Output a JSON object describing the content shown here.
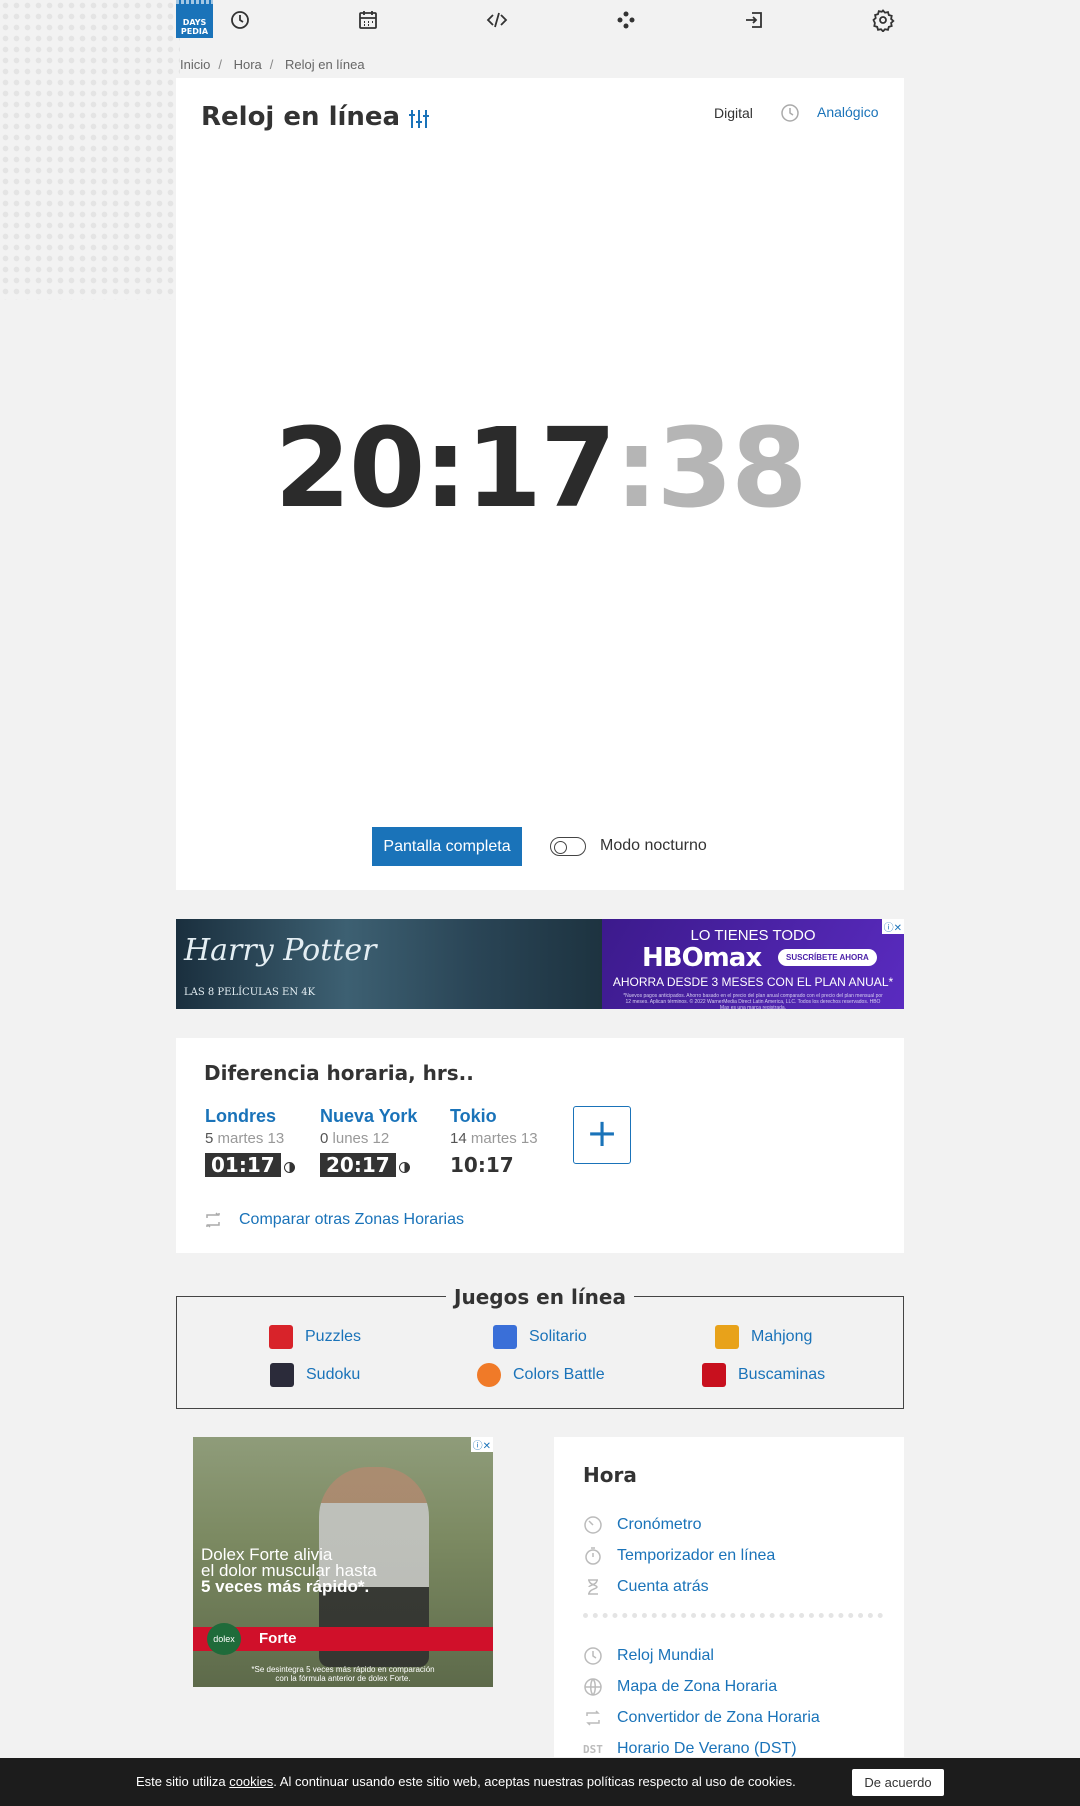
{
  "nav": {
    "logo_line1": "DAYS",
    "logo_line2": "PEDIA",
    "icons": [
      "clock-icon",
      "calendar-icon",
      "code-icon",
      "games-icon",
      "login-icon",
      "gear-icon"
    ]
  },
  "breadcrumb": [
    "Inicio",
    "Hora",
    "Reloj en línea"
  ],
  "clock": {
    "title": "Reloj en línea",
    "mode_digital": "Digital",
    "mode_analog": "Analógico",
    "hours_minutes": "20:17",
    "seconds": ":38",
    "fullscreen_label": "Pantalla completa",
    "night_mode_label": "Modo nocturno",
    "night_mode_on": false
  },
  "ad_banner": {
    "left_title": "Harry Potter",
    "left_sub": "LAS 8 PELÍCULAS EN 4K",
    "right_line1": "LO TIENES TODO",
    "right_brand": "HBOmax",
    "right_cta": "SUSCRÍBETE AHORA",
    "right_line3": "AHORRA DESDE 3 MESES CON EL PLAN ANUAL*",
    "right_fine": "*Nuevos pagos anticipados. Ahorro basado en el precio del plan anual comparado con el precio del plan mensual por 12 meses. Aplican términos. © 2022 WarnerMedia Direct Latin America, LLC. Todos los derechos reservados. HBO Max es una marca registrada.",
    "close": "ⓘ✕"
  },
  "time_diff": {
    "title": "Diferencia horaria, hrs..",
    "cities": [
      {
        "name": "Londres",
        "offset": "5",
        "day": "martes 13",
        "time": "01:17",
        "night": true
      },
      {
        "name": "Nueva York",
        "offset": "0",
        "day": "lunes 12",
        "time": "20:17",
        "night": true
      },
      {
        "name": "Tokio",
        "offset": "14",
        "day": "martes 13",
        "time": "10:17",
        "night": false
      }
    ],
    "add_label": "+",
    "compare_label": "Comparar otras Zonas Horarias"
  },
  "games": {
    "title": "Juegos en línea",
    "items": [
      {
        "label": "Puzzles",
        "color": "#d8232a"
      },
      {
        "label": "Solitario",
        "color": "#3a6fd8"
      },
      {
        "label": "Mahjong",
        "color": "#e8a21a"
      },
      {
        "label": "Sudoku",
        "color": "#2b2b3a"
      },
      {
        "label": "Colors Battle",
        "color": "#f07a28"
      },
      {
        "label": "Buscaminas",
        "color": "#c8101e"
      }
    ]
  },
  "ad_bottom": {
    "line1": "Dolex Forte alivia",
    "line2": "el dolor muscular hasta",
    "line3": "5 veces más rápido*.",
    "badge": "dolex",
    "bar": "Forte",
    "fine1": "*Se desintegra 5 veces más rápido en comparación",
    "fine2": "con la fórmula anterior de dolex Forte.",
    "close": "ⓘ✕"
  },
  "sidebar": {
    "title": "Hora",
    "group1": [
      {
        "label": "Cronómetro",
        "icon": "stopwatch-icon"
      },
      {
        "label": "Temporizador en línea",
        "icon": "timer-icon"
      },
      {
        "label": "Cuenta atrás",
        "icon": "countdown-icon"
      }
    ],
    "group2": [
      {
        "label": "Reloj Mundial",
        "icon": "clock-icon"
      },
      {
        "label": "Mapa de Zona Horaria",
        "icon": "globe-icon"
      },
      {
        "label": "Convertidor de Zona Horaria",
        "icon": "convert-icon"
      },
      {
        "label": "Horario De Verano (DST)",
        "icon": "dst-icon",
        "icon_text": "DST"
      }
    ]
  },
  "cookie": {
    "pre": "Este sitio utiliza ",
    "link": "cookies",
    "post": ". Al continuar usando este sitio web, aceptas nuestras políticas respecto al uso de cookies.",
    "button": "De acuerdo"
  }
}
